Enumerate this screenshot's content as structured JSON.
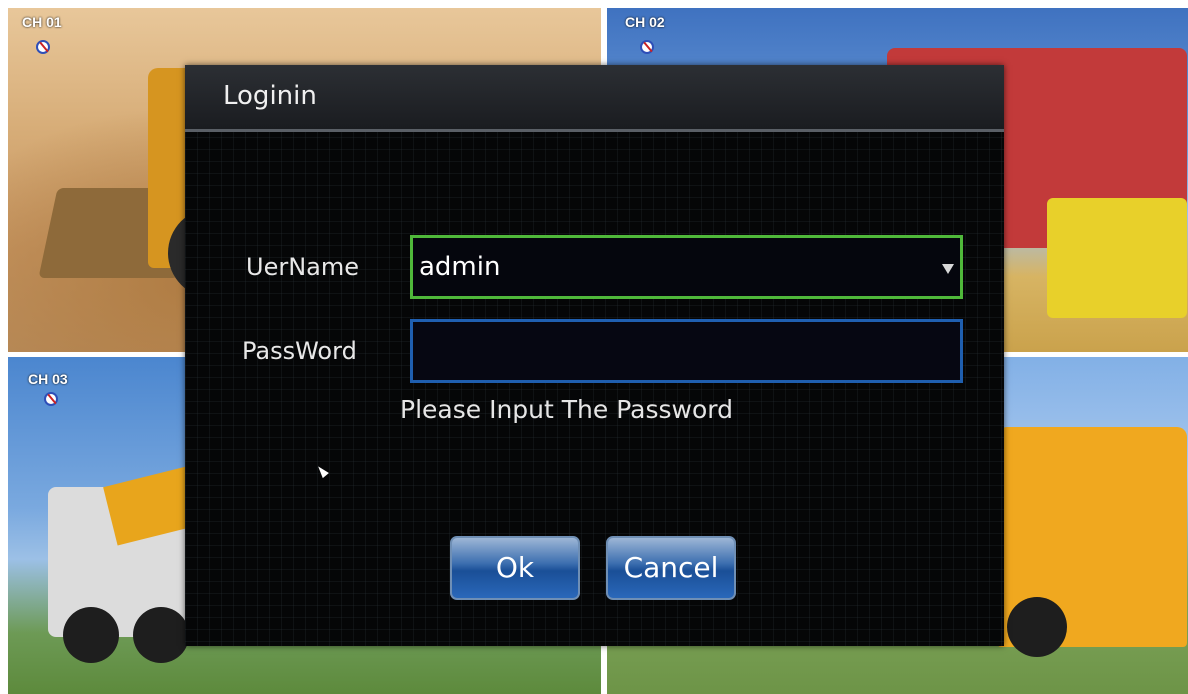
{
  "channels": [
    {
      "label": "CH 01"
    },
    {
      "label": "CH 02"
    },
    {
      "label": "CH 03"
    }
  ],
  "dialog": {
    "title": "Loginin",
    "username_label": "UerName",
    "username_value": "admin",
    "password_label": "PassWord",
    "password_value": "",
    "hint": "Please Input The Password",
    "ok_label": "Ok",
    "cancel_label": "Cancel"
  },
  "colors": {
    "username_border": "#4fb83a",
    "password_border": "#1f5fb0",
    "button_blue": "#1a4f97"
  }
}
